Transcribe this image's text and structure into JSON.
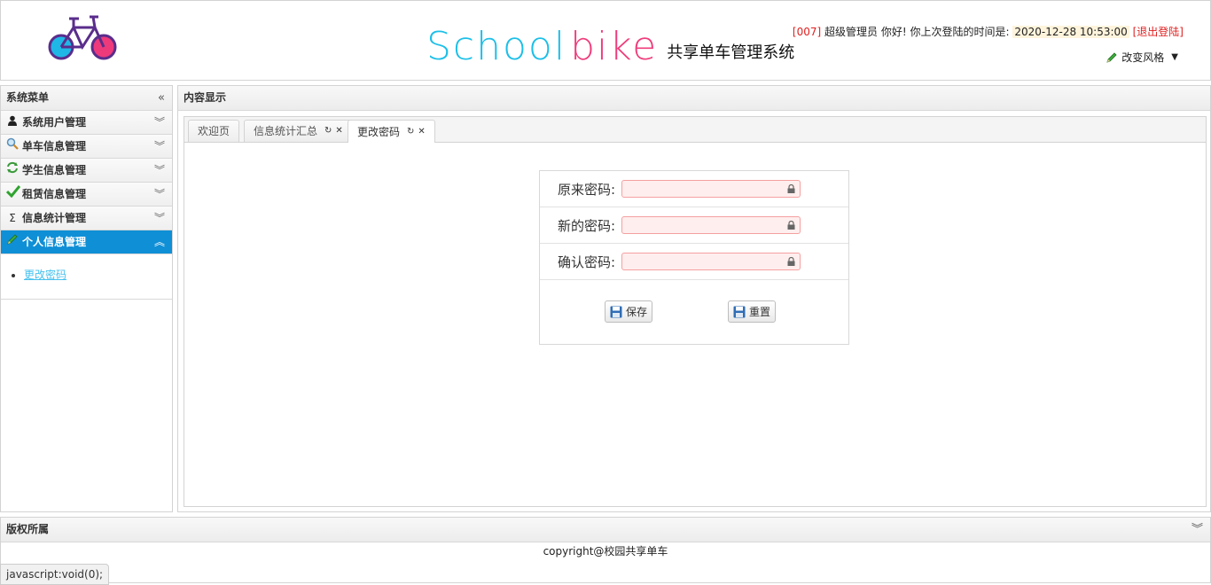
{
  "header": {
    "brand_school": "School",
    "brand_bike": "bike",
    "brand_subtitle": "共享单车管理系统",
    "user_id": "[007]",
    "user_role_greeting": "超级管理员 你好! 你上次登陆的时间是:",
    "last_login_time": "2020-12-28 10:53:00",
    "logout_label": "[退出登陆]",
    "change_style_label": "改变风格"
  },
  "sidebar": {
    "title": "系统菜单",
    "collapse_icon": "double-chevron-left-icon",
    "items": [
      {
        "label": "系统用户管理",
        "icon": "user-icon",
        "active": false
      },
      {
        "label": "单车信息管理",
        "icon": "magnifier-icon",
        "active": false
      },
      {
        "label": "学生信息管理",
        "icon": "refresh-icon",
        "active": false
      },
      {
        "label": "租赁信息管理",
        "icon": "check-icon",
        "active": false
      },
      {
        "label": "信息统计管理",
        "icon": "sigma-icon",
        "active": false
      },
      {
        "label": "个人信息管理",
        "icon": "pencil-icon",
        "active": true
      }
    ],
    "active_links": [
      "更改密码"
    ]
  },
  "content": {
    "title": "内容显示",
    "tabs": [
      {
        "label": "欢迎页",
        "closable": false,
        "active": false
      },
      {
        "label": "信息统计汇总",
        "closable": true,
        "active": false
      },
      {
        "label": "更改密码",
        "closable": true,
        "active": true
      }
    ],
    "form": {
      "fields": [
        {
          "label": "原来密码:",
          "value": ""
        },
        {
          "label": "新的密码:",
          "value": ""
        },
        {
          "label": "确认密码:",
          "value": ""
        }
      ],
      "save_label": "保存",
      "reset_label": "重置"
    }
  },
  "footer": {
    "title": "版权所属",
    "copyright": "copyright@校园共享单车"
  },
  "statusbar": {
    "text": "javascript:void(0);"
  },
  "colors": {
    "accent": "#0f8fd6",
    "brand_cyan": "#1bbfe8",
    "brand_pink": "#ef3d7c",
    "error_red": "#e02020",
    "input_invalid_bg": "#ffeeee"
  }
}
